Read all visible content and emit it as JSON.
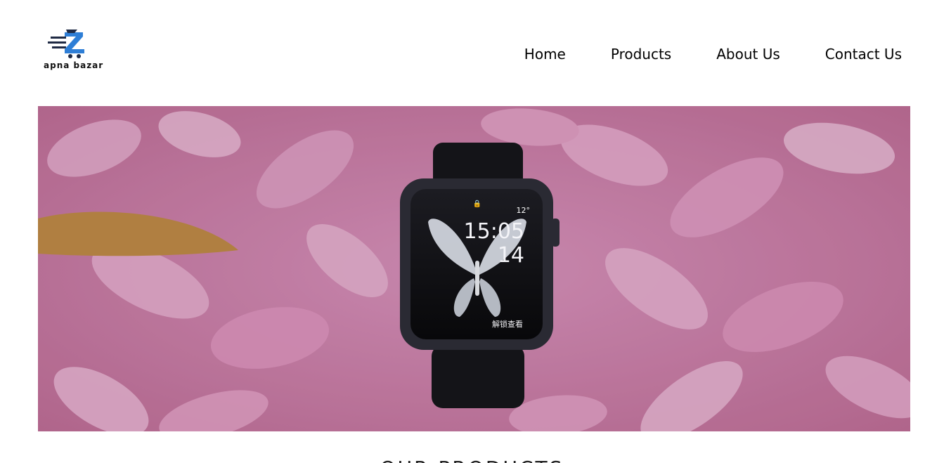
{
  "brand": {
    "name": "apna bazar",
    "logo_icon": "cart-logo-icon",
    "accent": "#2e7ed6"
  },
  "nav": {
    "items": [
      {
        "label": "Home"
      },
      {
        "label": "Products"
      },
      {
        "label": "About Us"
      },
      {
        "label": "Contact Us"
      }
    ]
  },
  "hero": {
    "image": "smartwatch-on-pink-petals",
    "watch": {
      "time": "15:05",
      "date": "14",
      "temp": "12°",
      "unlock_text": "解锁查看"
    }
  },
  "section": {
    "title": "OUR PRODUCTS"
  }
}
